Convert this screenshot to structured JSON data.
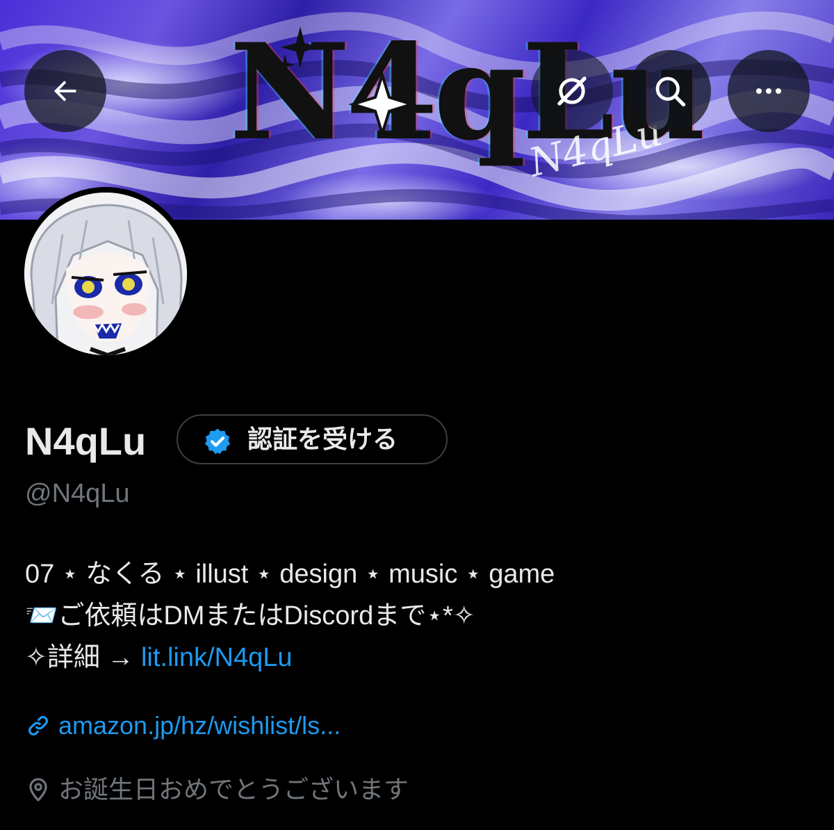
{
  "header": {
    "banner_logo_text": "N4qLu",
    "banner_signature": "N4qLu",
    "back_icon": "arrow-left-icon",
    "grok_icon": "grok-icon",
    "search_icon": "search-icon",
    "more_icon": "more-horizontal-icon"
  },
  "profile": {
    "display_name": "N4qLu",
    "verify_button_label": "認証を受ける",
    "verify_icon": "verified-badge-icon",
    "handle": "@N4qLu",
    "bio": {
      "line1": "07 ⋆ なくる ⋆ illust ⋆ design ⋆ music ⋆ game",
      "line2": "📨ご依頼はDMまたはDiscordまで⋆*✧",
      "line3_prefix": "✧詳細 → ",
      "line3_link": "lit.link/N4qLu"
    },
    "website": "amazon.jp/hz/wishlist/ls...",
    "location": "お誕生日おめでとうございます"
  },
  "colors": {
    "background": "#000000",
    "text_primary": "#e7e9ea",
    "text_secondary": "#71767b",
    "link": "#1d9bf0",
    "verify_badge": "#1d9bf0",
    "banner_purple": "#4a2fd8"
  }
}
